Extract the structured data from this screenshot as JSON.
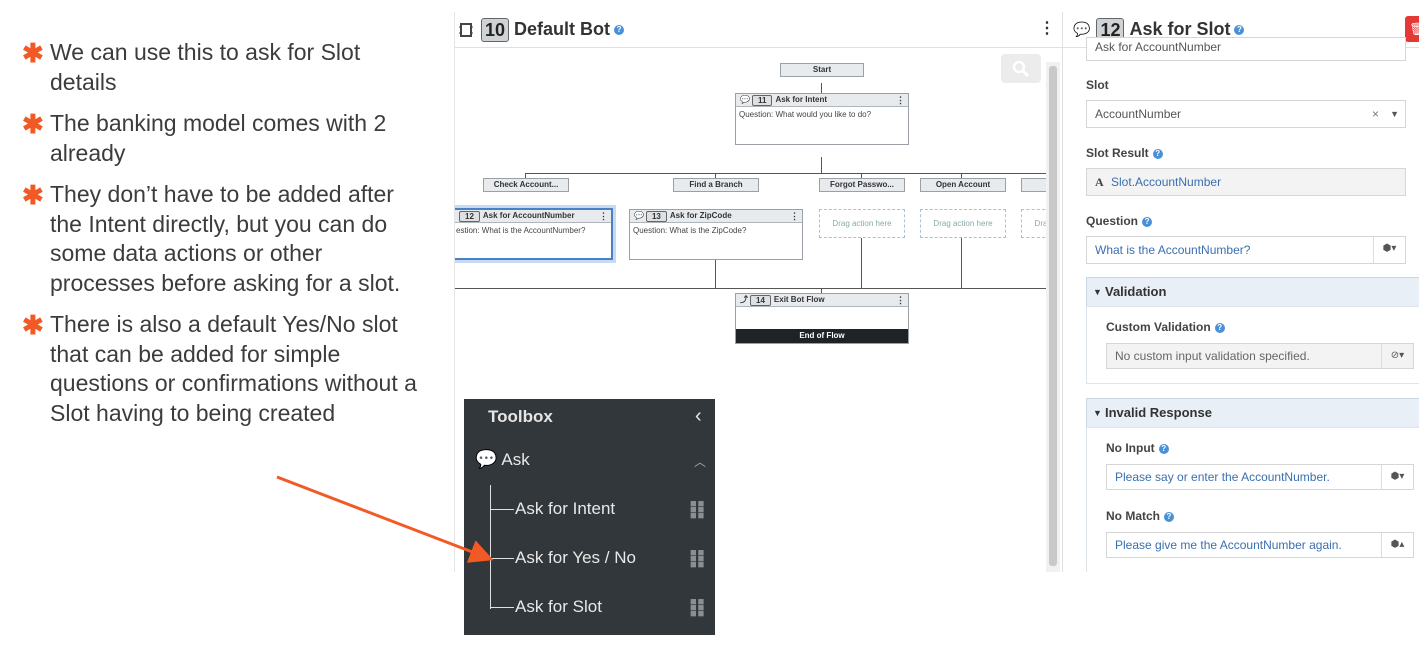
{
  "bullets": [
    "We can use this to ask for Slot details",
    "The banking model comes with 2 already",
    "They don’t have to be added after the Intent directly, but you can do some data actions or other processes before asking for a slot.",
    "There is also a default Yes/No slot that can be added for simple questions or confirmations without a Slot having to being created"
  ],
  "bullet_mark": "✱",
  "editor": {
    "number": "10",
    "title": "Default Bot",
    "kebab": "⋮",
    "zoom_icon": "search-icon",
    "start": "Start",
    "intent_node": {
      "number": "11",
      "title": "Ask for Intent",
      "body": "Question: What would you like to do?"
    },
    "branches": [
      "Check Account...",
      "Find a Branch",
      "Forgot Passwo...",
      "Open Account"
    ],
    "slot_node_1": {
      "number": "12",
      "title": "Ask for AccountNumber",
      "body": "estion: What is the AccountNumber?"
    },
    "slot_node_2": {
      "number": "13",
      "title": "Ask for ZipCode",
      "body": "Question: What is the ZipCode?"
    },
    "drag_label": "Drag action here",
    "drag_label_partial": "Dra",
    "exit_node": {
      "number": "14",
      "title": "Exit Bot Flow",
      "footer": "End of Flow"
    }
  },
  "panel": {
    "number": "12",
    "title": "Ask for Slot",
    "name_value": "Ask for AccountNumber",
    "slot_label": "Slot",
    "slot_value": "AccountNumber",
    "slot_result_label": "Slot Result",
    "slot_result_value": "Slot.AccountNumber",
    "question_label": "Question",
    "question_value": "What is the AccountNumber?",
    "validation_section": "Validation",
    "custom_validation_label": "Custom Validation",
    "custom_validation_value": "No custom input validation specified.",
    "invalid_section": "Invalid Response",
    "no_input_label": "No Input",
    "no_input_value": "Please say or enter the AccountNumber.",
    "no_match_label": "No Match",
    "no_match_value": "Please give me the AccountNumber again."
  },
  "toolbox": {
    "title": "Toolbox",
    "category": "Ask",
    "items": [
      "Ask for Intent",
      "Ask for Yes / No",
      "Ask for Slot"
    ]
  },
  "colors": {
    "accent": "#f15a24",
    "toolbox_bg": "#32373b",
    "link": "#3a6fb0",
    "delete": "#e53935"
  }
}
